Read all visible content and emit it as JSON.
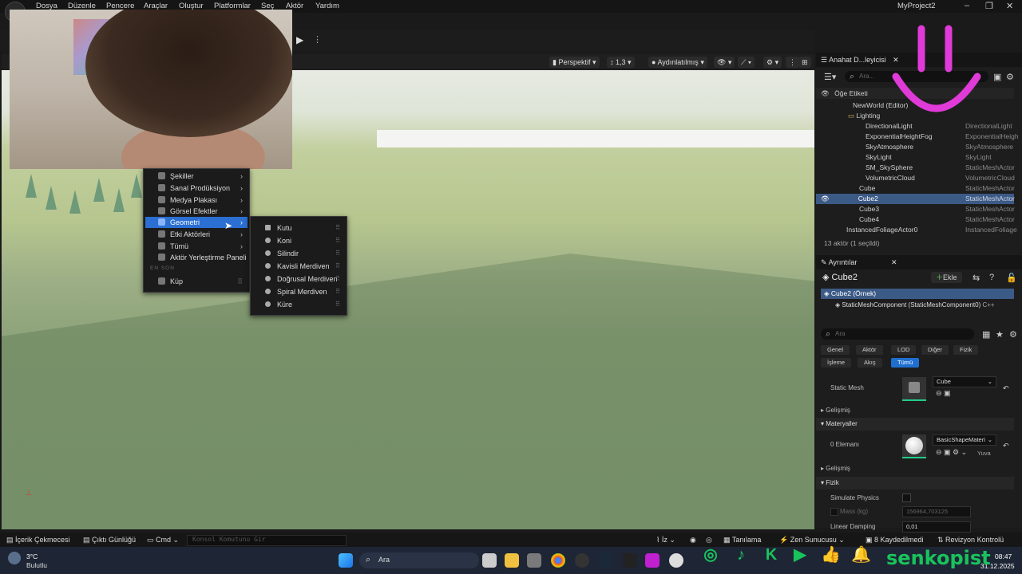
{
  "menubar": {
    "items": [
      "Dosya",
      "Düzenle",
      "Pencere",
      "Araçlar",
      "Oluştur",
      "Platformlar",
      "Seç",
      "Aktör",
      "Yardım"
    ],
    "project": "MyProject2"
  },
  "viewport": {
    "perspective": "Perspektif",
    "lit": "Aydınlatılmış",
    "fov": "1,3"
  },
  "context_menu": {
    "items": [
      "Şekiller",
      "Sanal Prodüksiyon",
      "Medya Plakası",
      "Görsel Efektler",
      "Geometri",
      "Etki Aktörleri",
      "Tümü",
      "Aktör Yerleştirme Paneli"
    ],
    "recent_header": "EN SON",
    "recent_item": "Küp"
  },
  "submenu": {
    "items": [
      "Kutu",
      "Koni",
      "Silindir",
      "Kavisli Merdiven",
      "Doğrusal Merdiven",
      "Spiral Merdiven",
      "Küre"
    ]
  },
  "outliner": {
    "tab": "Anahat D...leyicisi",
    "search_placeholder": "Ara...",
    "header": "Öğe Etiketi",
    "rows": [
      {
        "label": "NewWorld (Editor)",
        "type": ""
      },
      {
        "label": "Lighting",
        "type": ""
      },
      {
        "label": "DirectionalLight",
        "type": "DirectionalLight"
      },
      {
        "label": "ExponentialHeightFog",
        "type": "ExponentialHeigh"
      },
      {
        "label": "SkyAtmosphere",
        "type": "SkyAtmosphere"
      },
      {
        "label": "SkyLight",
        "type": "SkyLight"
      },
      {
        "label": "SM_SkySphere",
        "type": "StaticMeshActor"
      },
      {
        "label": "VolumetricCloud",
        "type": "VolumetricCloud"
      },
      {
        "label": "Cube",
        "type": "StaticMeshActor"
      },
      {
        "label": "Cube2",
        "type": "StaticMeshActor"
      },
      {
        "label": "Cube3",
        "type": "StaticMeshActor"
      },
      {
        "label": "Cube4",
        "type": "StaticMeshActor"
      },
      {
        "label": "InstancedFoliageActor0",
        "type": "InstancedFoliage"
      }
    ],
    "footer": "13 aktör (1 seçildi)"
  },
  "details": {
    "tab": "Ayrıntılar",
    "actor_name": "Cube2",
    "add_label": "Ekle",
    "instance": "Cube2 (Örnek)",
    "component": "StaticMeshComponent (StaticMeshComponent0)",
    "component_suffix": "C++",
    "search_placeholder": "Ara",
    "categories": [
      "Genel",
      "Aktör",
      "LOD",
      "Diğer",
      "Fizik",
      "İşleme",
      "Akış",
      "Tümü"
    ],
    "static_mesh_label": "Static Mesh",
    "static_mesh_value": "Cube",
    "advanced": "Gelişmiş",
    "materials_section": "Materyaller",
    "element0": "0 Elemanı",
    "material_value": "BasicShapeMateri",
    "yuva": "Yuva",
    "physics_section": "Fizik",
    "simulate_physics": "Simulate Physics",
    "mass_label": "Mass (kg)",
    "mass_value": "156964,703125",
    "linear_damping": "Linear Damping",
    "linear_damping_value": "0,01"
  },
  "statusbar": {
    "content_drawer": "İçerik Çekmecesi",
    "output_log": "Çıktı Günlüğü",
    "cmd": "Cmd",
    "console_placeholder": "Konsol Komutunu Gir",
    "iz": "İz",
    "tanilama": "Tanılama",
    "zen": "Zen Sunucusu",
    "unsaved": "8 Kaydedilmedi",
    "revision": "Revizyon Kontrolü"
  },
  "taskbar": {
    "temp": "3°C",
    "weather": "Bulutlu",
    "search": "Ara",
    "time": "08:47",
    "date": "31.12.2025"
  },
  "overlay": {
    "brand": "senkopist"
  },
  "colors": {
    "accent": "#2a6fd1",
    "brand_green": "#19c35c",
    "smile_magenta": "#e03ad8"
  }
}
